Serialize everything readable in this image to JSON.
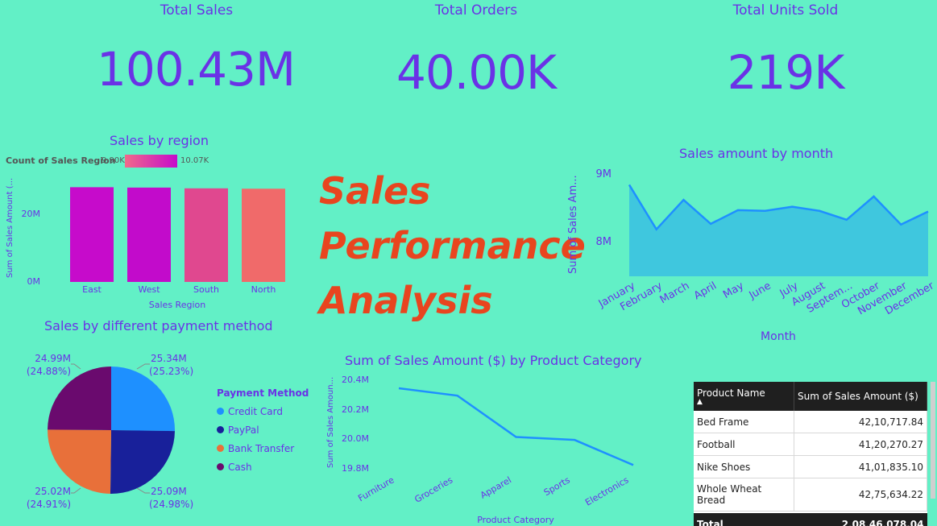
{
  "kpis": [
    {
      "title": "Total Sales",
      "value": "100.43M"
    },
    {
      "title": "Total Orders",
      "value": "40.00K"
    },
    {
      "title": "Total Units Sold",
      "value": "219K"
    }
  ],
  "dashboard_title": [
    "Sales",
    "Performance",
    "Analysis"
  ],
  "colors": {
    "background": "#62f0c6",
    "accent": "#6a32e6",
    "title": "#e8451f"
  },
  "region_chart": {
    "title": "Sales by region",
    "legend_label": "Count of Sales Region",
    "legend_min": "9.90K",
    "legend_max": "10.07K",
    "ylabel": "Sum of Sales Amount (...",
    "xlabel": "Sales Region",
    "ytick_labels": [
      "0M",
      "20M"
    ]
  },
  "month_chart": {
    "title": "Sales amount by month",
    "ylabel": "Sum of Sales Am...",
    "xlabel": "Month",
    "ytick_labels": [
      "8M",
      "9M"
    ],
    "xtick_labels": [
      "January",
      "February",
      "March",
      "April",
      "May",
      "June",
      "July",
      "August",
      "Septem...",
      "October",
      "November",
      "December"
    ]
  },
  "payment_chart": {
    "title": "Sales by different payment method",
    "legend_title": "Payment Method",
    "labels": [
      {
        "value": "25.34M",
        "pct": "(25.23%)"
      },
      {
        "value": "25.09M",
        "pct": "(24.98%)"
      },
      {
        "value": "25.02M",
        "pct": "(24.91%)"
      },
      {
        "value": "24.99M",
        "pct": "(24.88%)"
      }
    ]
  },
  "category_chart": {
    "title": "Sum of Sales Amount ($) by Product Category",
    "ylabel": "Sum of Sales Amoun...",
    "xlabel": "Product Category",
    "ytick_labels": [
      "19.8M",
      "20.0M",
      "20.2M",
      "20.4M"
    ]
  },
  "product_table": {
    "headers": [
      "Product Name",
      "Sum of Sales Amount ($)"
    ],
    "rows": [
      {
        "name": "Bed Frame",
        "amount": "42,10,717.84"
      },
      {
        "name": "Football",
        "amount": "41,20,270.27"
      },
      {
        "name": "Nike Shoes",
        "amount": "41,01,835.10"
      },
      {
        "name": "Whole Wheat Bread",
        "amount": "42,75,634.22"
      }
    ],
    "total_label": "Total",
    "total_value": "2,08,46,078.04"
  },
  "chart_data": [
    {
      "type": "bar",
      "title": "Sales by region",
      "categories": [
        "East",
        "West",
        "South",
        "North"
      ],
      "values": [
        25.2,
        25.1,
        24.9,
        24.8
      ],
      "value_unit": "M",
      "colors": [
        "#c60bcb",
        "#c20bcb",
        "#e0488f",
        "#f06a6a"
      ],
      "xlabel": "Sales Region",
      "ylabel": "Sum of Sales Amount (...",
      "ylim": [
        0,
        30
      ]
    },
    {
      "type": "area",
      "title": "Sales amount by month",
      "categories": [
        "January",
        "February",
        "March",
        "April",
        "May",
        "June",
        "July",
        "August",
        "Septem...",
        "October",
        "November",
        "December"
      ],
      "values": [
        8.83,
        8.18,
        8.61,
        8.26,
        8.46,
        8.45,
        8.51,
        8.45,
        8.32,
        8.66,
        8.25,
        8.44
      ],
      "value_unit": "M",
      "xlabel": "Month",
      "ylabel": "Sum of Sales Am...",
      "ylim": [
        8.0,
        9.0
      ],
      "color": "#3fc7de"
    },
    {
      "type": "pie",
      "title": "Sales by different payment method",
      "labels": [
        "Credit Card",
        "PayPal",
        "Bank Transfer",
        "Cash"
      ],
      "values": [
        25.34,
        25.09,
        25.02,
        24.99
      ],
      "percent": [
        25.23,
        24.98,
        24.91,
        24.88
      ],
      "colors": [
        "#1e90ff",
        "#18209a",
        "#e8703a",
        "#6a0a6e"
      ]
    },
    {
      "type": "line",
      "title": "Sum of Sales Amount ($) by Product Category",
      "categories": [
        "Furniture",
        "Groceries",
        "Apparel",
        "Sports",
        "Electronics"
      ],
      "values": [
        20.34,
        20.29,
        20.01,
        19.99,
        19.82
      ],
      "value_unit": "M",
      "xlabel": "Product Category",
      "ylabel": "Sum of Sales Amoun...",
      "ylim": [
        19.78,
        20.42
      ],
      "color": "#1e90ff"
    }
  ]
}
